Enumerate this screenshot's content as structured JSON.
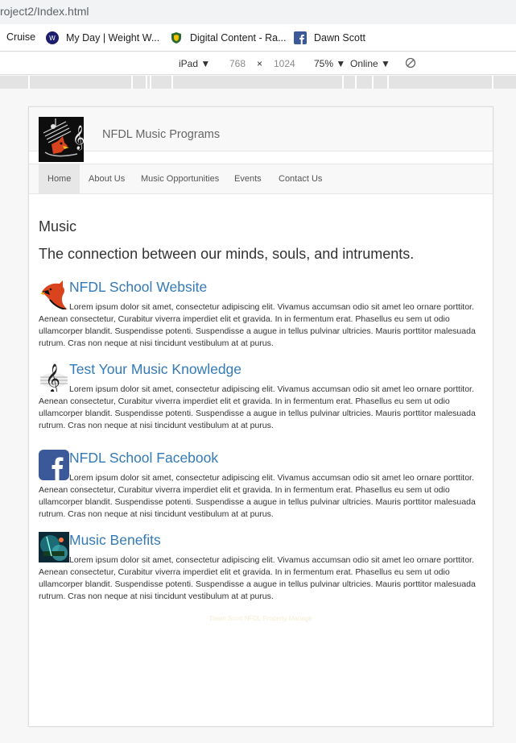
{
  "browser": {
    "url": "roject2/Index.html",
    "bookmarks": [
      {
        "label": "Cruise",
        "icon": "none"
      },
      {
        "label": "My Day | Weight W...",
        "icon": "ww-logo-icon"
      },
      {
        "label": "Digital Content - Ra...",
        "icon": "shield-icon"
      },
      {
        "label": "Dawn Scott",
        "icon": "facebook-icon"
      }
    ]
  },
  "device_toolbar": {
    "device": "iPad",
    "width": "768",
    "times": "×",
    "height": "1024",
    "zoom": "75%",
    "network": "Online"
  },
  "site": {
    "brand": "NFDL Music Programs",
    "nav": [
      "Home",
      "About Us",
      "Music Opportunities",
      "Events",
      "Contact Us"
    ],
    "heading": "Music",
    "subheading": "The connection between our minds, souls, and intruments.",
    "sections": [
      {
        "title": "NFDL School Website",
        "icon": "cardinal-icon",
        "body": "Lorem ipsum dolor sit amet, consectetur adipiscing elit. Vivamus accumsan odio sit amet leo ornare porttitor. Aenean consectetur, Curabitur viverra imperdiet elit et gravida. In in fermentum erat. Phasellus eu sem ut odio ullamcorper blandit. Suspendisse potenti. Suspendisse a augue in tellus pulvinar ultricies. Mauris porttitor malesuada rutrum. Cras non neque at nisi tincidunt vestibulum at at purus."
      },
      {
        "title": "Test Your Music Knowledge",
        "icon": "treble-clef-icon",
        "body": "Lorem ipsum dolor sit amet, consectetur adipiscing elit. Vivamus accumsan odio sit amet leo ornare porttitor. Aenean consectetur, Curabitur viverra imperdiet elit et gravida. In in fermentum erat. Phasellus eu sem ut odio ullamcorper blandit. Suspendisse potenti. Suspendisse a augue in tellus pulvinar ultricies. Mauris porttitor malesuada rutrum. Cras non neque at nisi tincidunt vestibulum at at purus."
      },
      {
        "title": "NFDL School Facebook",
        "icon": "facebook-icon",
        "body": "Lorem ipsum dolor sit amet, consectetur adipiscing elit. Vivamus accumsan odio sit amet leo ornare porttitor. Aenean consectetur, Curabitur viverra imperdiet elit et gravida. In in fermentum erat. Phasellus eu sem ut odio ullamcorper blandit. Suspendisse potenti. Suspendisse a augue in tellus pulvinar ultricies. Mauris porttitor malesuada rutrum. Cras non neque at nisi tincidunt vestibulum at at purus."
      },
      {
        "title": "Music Benefits",
        "icon": "music-photo-icon",
        "body": "Lorem ipsum dolor sit amet, consectetur adipiscing elit. Vivamus accumsan odio sit amet leo ornare porttitor. Aenean consectetur, Curabitur viverra imperdiet elit et gravida. In in fermentum erat. Phasellus eu sem ut odio ullamcorper blandit. Suspendisse potenti. Suspendisse a augue in tellus pulvinar ultricies. Mauris porttitor malesuada rutrum. Cras non neque at nisi tincidunt vestibulum at at purus."
      }
    ],
    "footer": "Dawn Scott NFDL Property Manage"
  },
  "colors": {
    "link": "#337ab7",
    "nav_active": "#e7e7e7",
    "facebook": "#3b5998",
    "cardinal": "#d9431e"
  }
}
